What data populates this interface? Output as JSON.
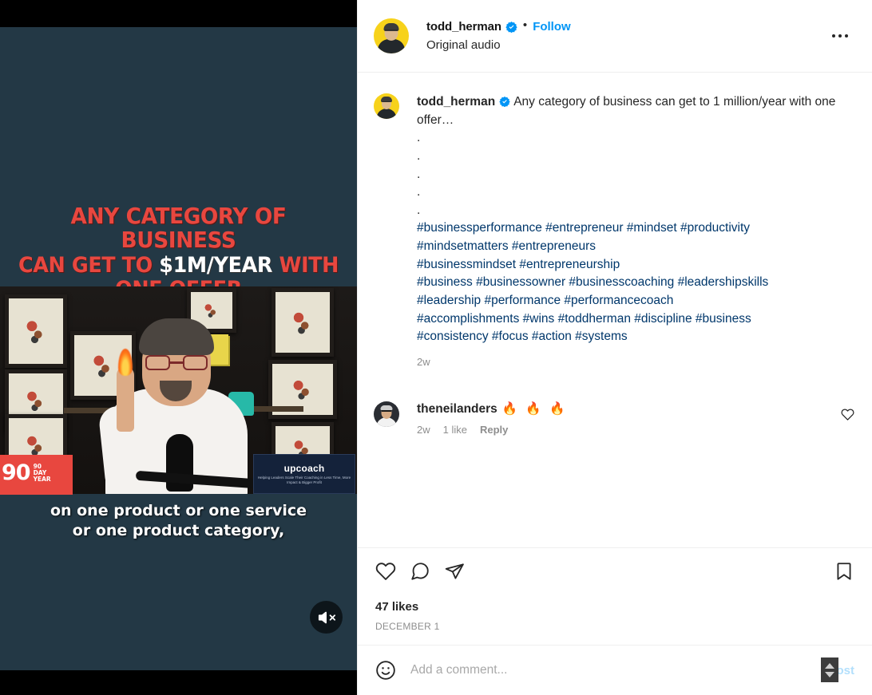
{
  "header": {
    "username": "todd_herman",
    "verified_icon": "verified-badge-icon",
    "separator": "•",
    "follow_label": "Follow",
    "audio_label": "Original audio",
    "more_icon": "more-options-icon"
  },
  "caption": {
    "username": "todd_herman",
    "text": "Any category of business can get to 1 million/year with one offer…",
    "dot_lines": [
      ".",
      ".",
      ".",
      ".",
      "."
    ],
    "hashtag_lines": [
      "#businessperformance #entrepreneur #mindset #productivity",
      "#mindsetmatters #entrepreneurs",
      "#businessmindset #entrepreneurship",
      "#business #businessowner #businesscoaching #leadershipskills",
      "#leadership #performance #performancecoach",
      "#accomplishments #wins #toddherman #discipline #business",
      "#consistency #focus #action #systems"
    ],
    "time_ago": "2w"
  },
  "comment": {
    "username": "theneilanders",
    "emoji": "🔥 🔥 🔥",
    "time_ago": "2w",
    "likes": "1 like",
    "reply_label": "Reply",
    "like_icon": "heart-icon"
  },
  "actions": {
    "like_icon": "heart-icon",
    "comment_icon": "comment-bubble-icon",
    "share_icon": "share-paper-plane-icon",
    "save_icon": "bookmark-icon",
    "likes_count": "47 likes",
    "date": "DECEMBER 1"
  },
  "composer": {
    "emoji_icon": "emoji-smiley-icon",
    "placeholder": "Add a comment...",
    "value": "",
    "post_label": "Post",
    "spinner_icon": "stepper-spinner-icon"
  },
  "video": {
    "headline_line1": "ANY CATEGORY OF BUSINESS",
    "headline_line2_pre": "CAN GET TO ",
    "headline_line2_hi": "$1M/YEAR",
    "headline_line2_post": " WITH ONE OFFER",
    "subtitle_line1": "on one product or one service",
    "subtitle_line2": "or one product category,",
    "badge_number": "90",
    "badge_day": "DAY",
    "badge_year": "YEAR",
    "overlay_brand": "upcoach",
    "overlay_brand_sub": "Helping Leaders Scale Their Coaching in Less Time, More Impact & Bigger Profit",
    "mute_icon": "speaker-muted-icon"
  },
  "colors": {
    "ig_blue": "#0095f6",
    "link_blue": "#00376b",
    "post_blue": "#b2dffc",
    "accent_red": "#e8473f",
    "video_bg": "#233845",
    "text": "#262626",
    "muted": "#8e8e8e"
  }
}
